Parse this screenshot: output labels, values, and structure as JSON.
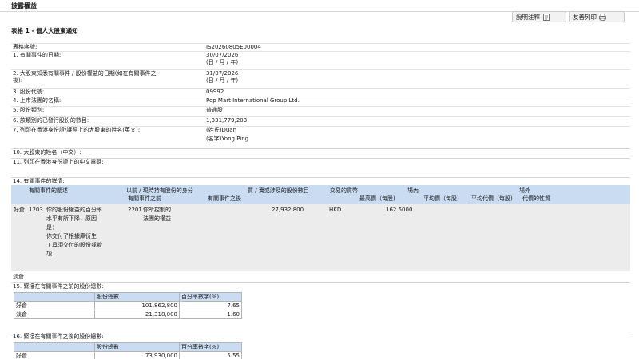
{
  "page_title": "披露權益",
  "toolbar": {
    "notes_label": "說明注釋",
    "print_label": "友善列印"
  },
  "table_title": "表格 1 - 個人大股東通知",
  "fields": [
    {
      "label": "表格序號:",
      "value": "IS20260805E00004"
    },
    {
      "label": "1. 有關事件的日期:",
      "value": "30/07/2026"
    },
    {
      "label": "",
      "value": "(日 / 月 / 年)"
    },
    {
      "label": "2. 大股東知悉有關事件 / 股份權益的日期(如在有關事件之",
      "value": "31/07/2026"
    },
    {
      "label": "後):",
      "value": "(日 / 月 / 年)"
    },
    {
      "label": "3. 股份代號:",
      "value": "09992"
    },
    {
      "label": "4. 上市法團的名稱:",
      "value": "Pop Mart International Group Ltd."
    },
    {
      "label": "5. 股份類別:",
      "value": "普通股"
    },
    {
      "label": "6. 該類別的已發行股份的數目:",
      "value": "1,331,779,203"
    },
    {
      "label": "7. 列印在香港身份證/護照上的大股東的姓名(英文):",
      "value": "(姓氏)Duan"
    },
    {
      "label": "",
      "value": "(名字)Yong Ping"
    }
  ],
  "section10": "10. 大股東的姓名（中文）:",
  "section11": "11. 列印在香港身份證上的中文電碼:",
  "section14": "14. 有關事件的詳情:",
  "events_header": {
    "event_col": "有關事件的闡述",
    "capacity_group": "以前 / 現時持有股份的身分",
    "capacity_before": "有關事件之前",
    "capacity_after": "有關事件之後",
    "shares_col": "買 / 賣或涉及的股份數目",
    "currency_col": "交易的貨幣",
    "onexchange_group": "場內",
    "highest_price": "最高價（每股)",
    "average_price": "平均價（每股)",
    "offexchange_group": "場外",
    "avg_consideration": "平均代價（每股)",
    "consideration_nature": "代價的性質"
  },
  "event_row": {
    "position": "好倉",
    "event_code": "1203",
    "event_desc": [
      "你的股份權益的百分率",
      "水平有所下降，原因",
      "是：",
      "你交付了根據庫衍生",
      "工具須交付的股份或款",
      "項"
    ],
    "capacity_code": "2201",
    "capacity_desc": [
      "你所控制的",
      "法團的權益"
    ],
    "shares": "27,932,800",
    "currency": "HKD",
    "highest_price": "162.5000"
  },
  "short_label": "淡倉",
  "section15": {
    "title": "15. 緊接在有關事件之前的股份總數:",
    "col_shares": "股份總數",
    "col_pct": "百分率數字(%)",
    "rows": [
      {
        "label": "好倉",
        "shares": "101,862,800",
        "pct": "7.65"
      },
      {
        "label": "淡倉",
        "shares": "21,318,000",
        "pct": "1.60"
      }
    ]
  },
  "section16": {
    "title": "16. 緊接在有關事件之後的股份總數:",
    "col_shares": "股份總數",
    "col_pct": "百分率數字(%)",
    "rows": [
      {
        "label": "好倉",
        "shares": "73,930,000",
        "pct": "5.55"
      }
    ]
  }
}
